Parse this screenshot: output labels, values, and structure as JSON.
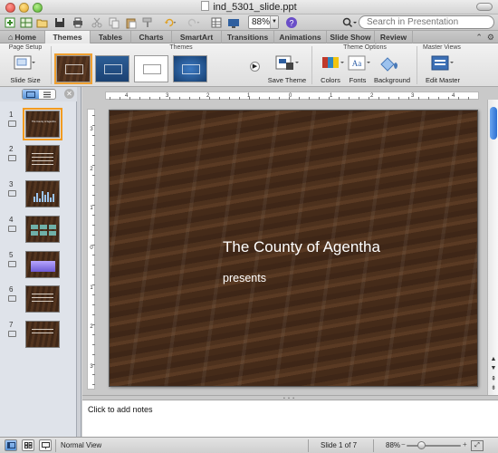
{
  "window": {
    "title": "ind_5301_slide.ppt"
  },
  "toolbar": {
    "zoom_value": "88%",
    "search_placeholder": "Search in Presentation"
  },
  "ribbon": {
    "tabs": [
      {
        "label": "Home"
      },
      {
        "label": "Themes"
      },
      {
        "label": "Tables"
      },
      {
        "label": "Charts"
      },
      {
        "label": "SmartArt"
      },
      {
        "label": "Transitions"
      },
      {
        "label": "Animations"
      },
      {
        "label": "Slide Show"
      },
      {
        "label": "Review"
      }
    ],
    "active_tab": "Themes",
    "groups": {
      "page_setup": {
        "label": "Page Setup",
        "slide_size": "Slide Size"
      },
      "themes": {
        "label": "Themes",
        "save_theme": "Save Theme"
      },
      "theme_options": {
        "label": "Theme Options",
        "colors": "Colors",
        "fonts": "Fonts",
        "background": "Background"
      },
      "master_views": {
        "label": "Master Views",
        "edit_master": "Edit Master"
      }
    }
  },
  "ruler": {
    "horizontal_labels": [
      "4",
      "3",
      "2",
      "1",
      "0",
      "1",
      "2",
      "3",
      "4"
    ],
    "vertical_labels": [
      "3",
      "2",
      "1",
      "0",
      "1",
      "2",
      "3"
    ]
  },
  "navigator": {
    "slides": [
      {
        "num": "1",
        "title": "The County of Agentha"
      },
      {
        "num": "2"
      },
      {
        "num": "3"
      },
      {
        "num": "4"
      },
      {
        "num": "5"
      },
      {
        "num": "6"
      },
      {
        "num": "7"
      }
    ]
  },
  "slide": {
    "title": "The County of Agentha",
    "subtitle": "presents"
  },
  "notes": {
    "placeholder": "Click to add notes"
  },
  "status": {
    "view_name": "Normal View",
    "slide_position": "Slide 1 of 7",
    "zoom": "88%"
  },
  "colors": {
    "accent": "#5a95d8",
    "selection": "#f29b20",
    "wood_dark": "#3e2617"
  }
}
